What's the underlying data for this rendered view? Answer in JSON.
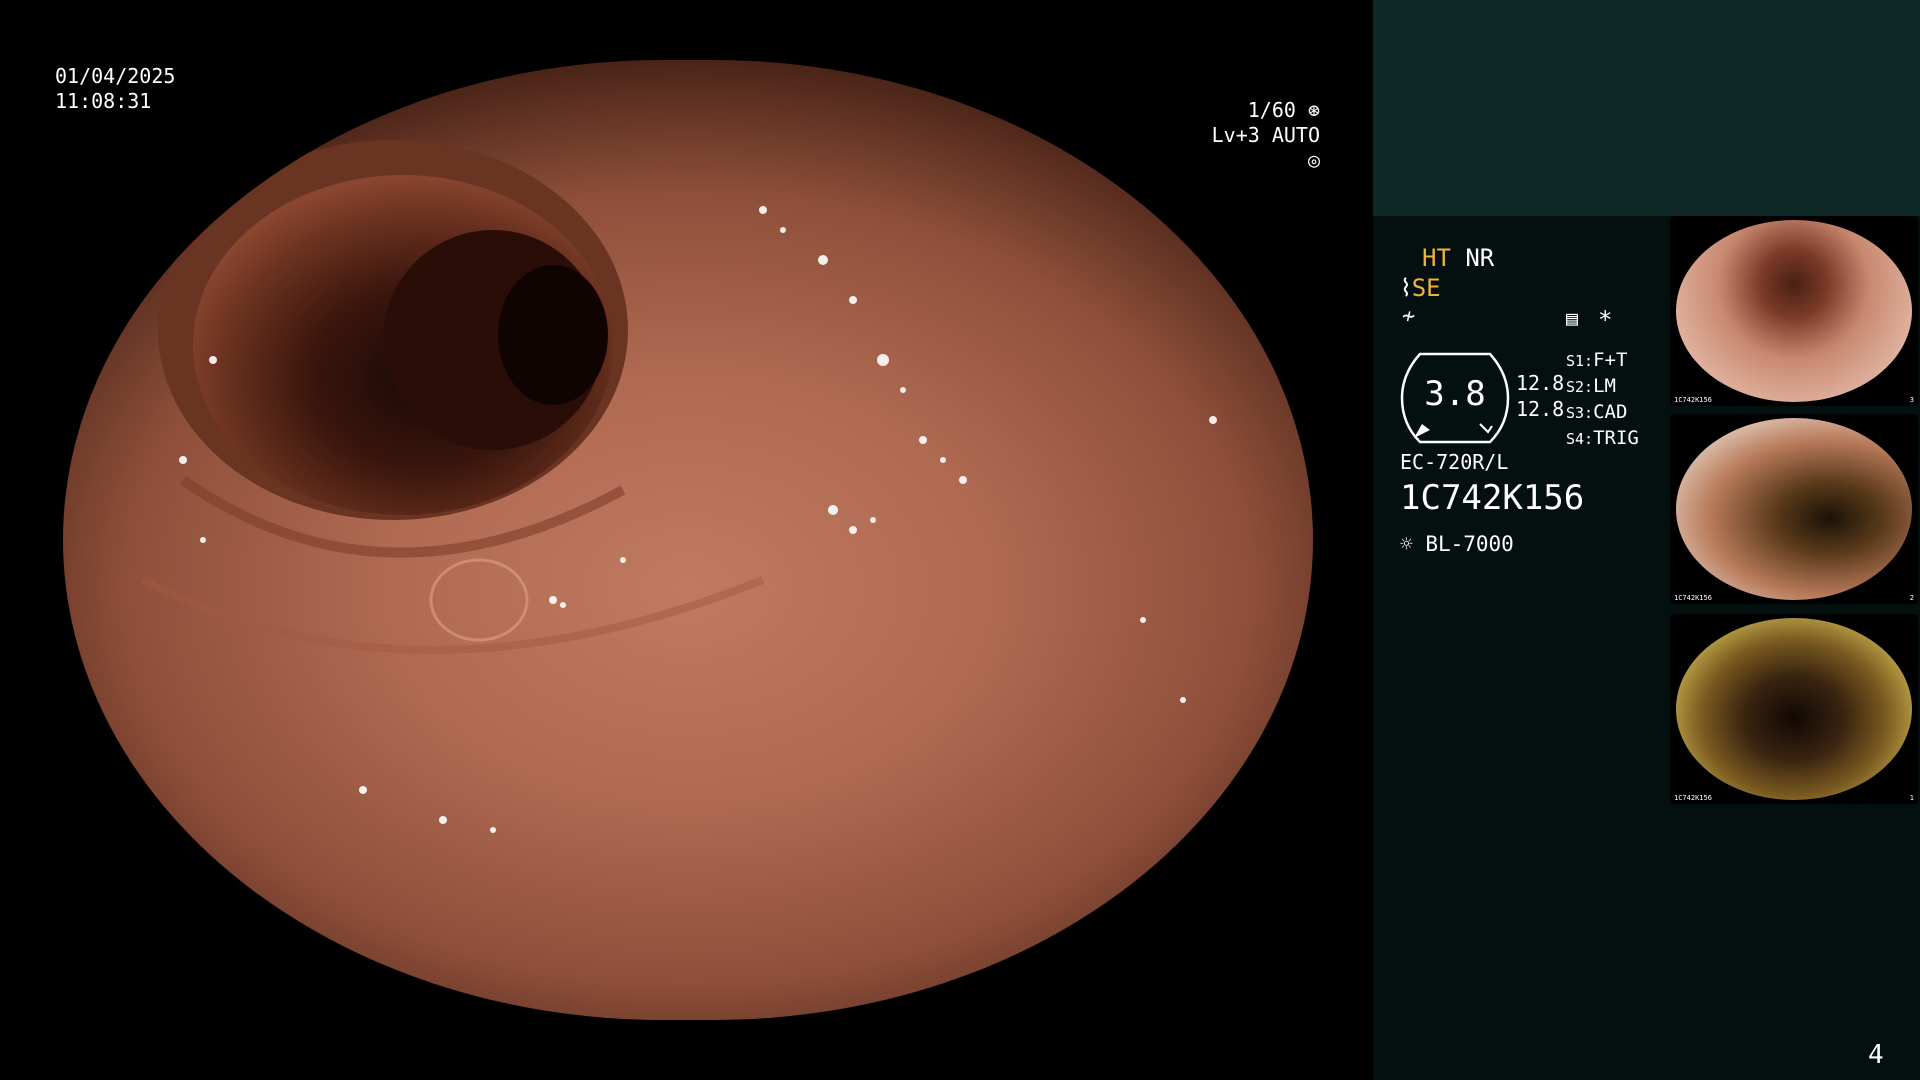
{
  "osd": {
    "date": "01/04/2025",
    "time": "11:08:31",
    "shutter": "1/60",
    "level": "Lv+3",
    "mode": "AUTO"
  },
  "panel": {
    "ht": "HT",
    "nr": "NR",
    "se": "SE",
    "meter_value": "3.8",
    "ratio_1": "12.8",
    "ratio_2": "12.8",
    "switches": [
      {
        "key": "S1:",
        "label": "F+T"
      },
      {
        "key": "S2:",
        "label": "LM"
      },
      {
        "key": "S3:",
        "label": "CAD"
      },
      {
        "key": "S4:",
        "label": "TRIG"
      }
    ],
    "asterisk": "*",
    "scope_model": "EC-720R/L",
    "serial": "1C742K156",
    "light_source": "BL-7000"
  },
  "thumbnails": [
    {
      "caption": "1C742K156",
      "index": "3"
    },
    {
      "caption": "1C742K156",
      "index": "2"
    },
    {
      "caption": "1C742K156",
      "index": "1"
    }
  ],
  "page_number": "4",
  "colors": {
    "accent_orange": "#f0b23c",
    "panel_bg": "#04100f",
    "panel_top_bg": "#0e2826"
  }
}
